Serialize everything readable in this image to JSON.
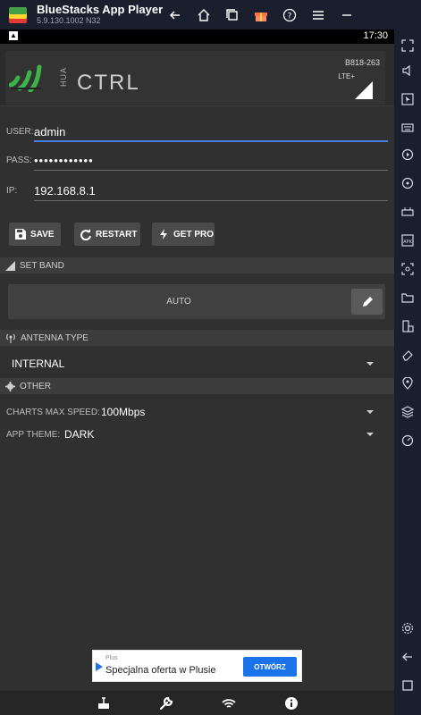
{
  "window": {
    "title": "BlueStacks App Player",
    "version": "5.9.130.1002  N32"
  },
  "statusbar": {
    "time": "17:30"
  },
  "header": {
    "logo_prefix": "HUA",
    "logo_word": "CTRL",
    "model": "B818-263",
    "network": "LTE+"
  },
  "credentials": {
    "user_label": "USER:",
    "user_value": "admin",
    "pass_label": "PASS:",
    "pass_value": "••••••••••••",
    "ip_label": "IP:",
    "ip_value": "192.168.8.1"
  },
  "actions": {
    "save": "SAVE",
    "restart": "RESTART",
    "get_pro": "GET PRO"
  },
  "set_band": {
    "title": "SET BAND",
    "value": "AUTO"
  },
  "antenna": {
    "title": "ANTENNA TYPE",
    "value": "INTERNAL"
  },
  "other": {
    "title": "OTHER",
    "charts_label": "CHARTS MAX SPEED:",
    "charts_value": "100Mbps",
    "theme_label": "APP THEME:",
    "theme_value": "DARK"
  },
  "ad": {
    "brand": "Plus",
    "text": "Specjalna oferta w Plusie",
    "cta": "OTWÓRZ"
  },
  "colors": {
    "accent": "#4a7de0",
    "logo_green": "#3cb44a",
    "background": "#303030",
    "chrome": "#1a1f2e"
  }
}
